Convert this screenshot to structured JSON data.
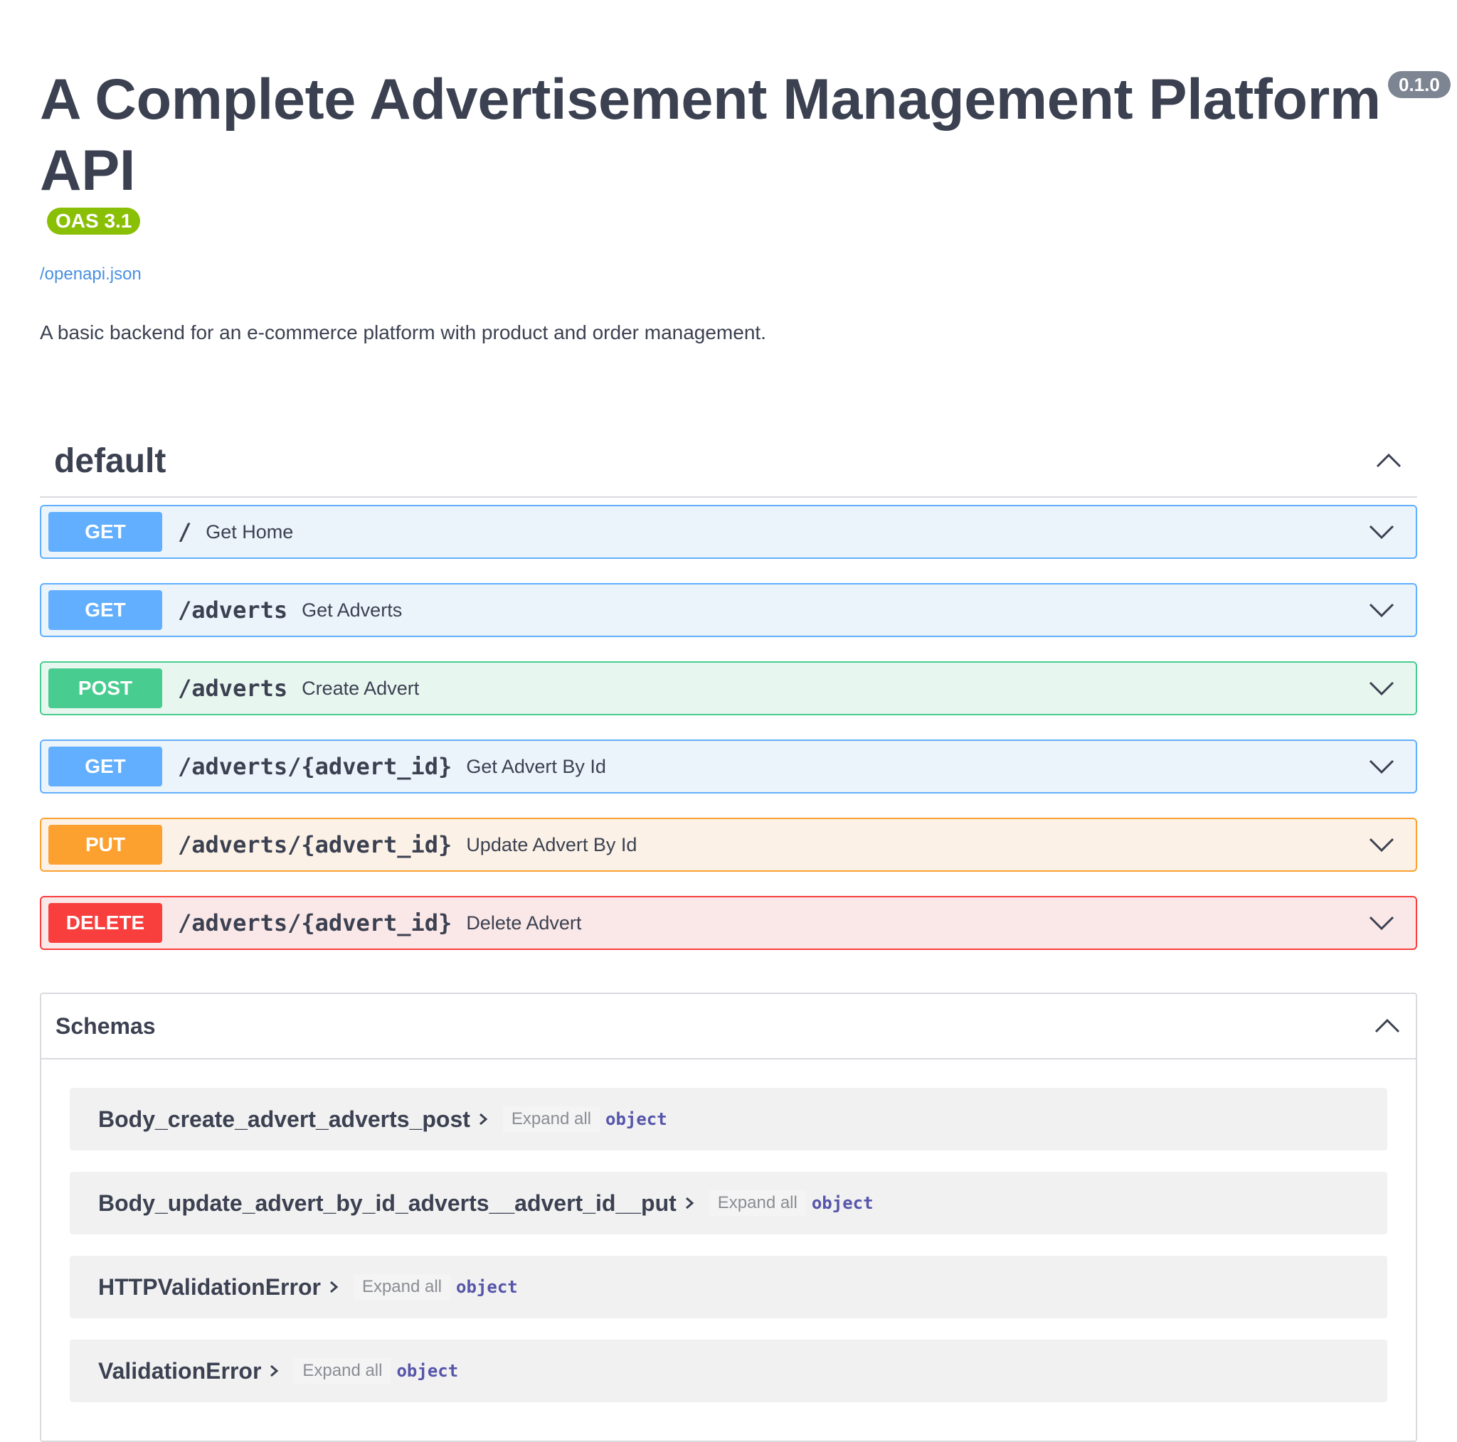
{
  "info": {
    "title": "A Complete Advertisement Management Platform API",
    "version": "0.1.0",
    "oas": "OAS 3.1",
    "spec_link": "/openapi.json",
    "description": "A basic backend for an e-commerce platform with product and order management."
  },
  "tag": {
    "name": "default"
  },
  "operations": [
    {
      "method": "GET",
      "path": "/",
      "summary": "Get Home"
    },
    {
      "method": "GET",
      "path": "/adverts",
      "summary": "Get Adverts"
    },
    {
      "method": "POST",
      "path": "/adverts",
      "summary": "Create Advert"
    },
    {
      "method": "GET",
      "path": "/adverts/{advert_id}",
      "summary": "Get Advert By Id"
    },
    {
      "method": "PUT",
      "path": "/adverts/{advert_id}",
      "summary": "Update Advert By Id"
    },
    {
      "method": "DELETE",
      "path": "/adverts/{advert_id}",
      "summary": "Delete Advert"
    }
  ],
  "schemas": {
    "title": "Schemas",
    "models": [
      {
        "name": "Body_create_advert_adverts_post",
        "expand": "Expand all",
        "type": "object"
      },
      {
        "name": "Body_update_advert_by_id_adverts__advert_id__put",
        "expand": "Expand all",
        "type": "object"
      },
      {
        "name": "HTTPValidationError",
        "expand": "Expand all",
        "type": "object"
      },
      {
        "name": "ValidationError",
        "expand": "Expand all",
        "type": "object"
      }
    ]
  },
  "colors": {
    "get": "#61affe",
    "post": "#49cc90",
    "put": "#fca130",
    "delete": "#f93e3e",
    "oas_badge": "#89bf04",
    "version_badge": "#7d8492",
    "link": "#4990e2"
  },
  "icons": {
    "collapse": "chevron-up-icon",
    "expand": "chevron-down-icon",
    "model_expand": "chevron-right-icon"
  }
}
